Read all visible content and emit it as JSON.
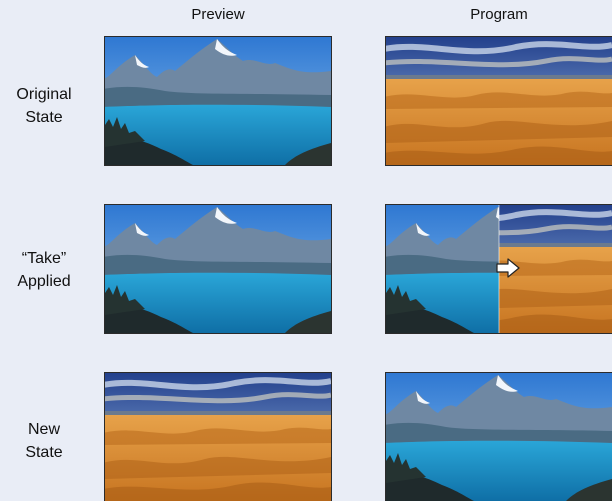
{
  "columns": {
    "preview": "Preview",
    "program": "Program"
  },
  "rows": [
    {
      "line1": "Original",
      "line2": "State"
    },
    {
      "line1": "“Take”",
      "line2": "Applied"
    },
    {
      "line1": "New",
      "line2": "State"
    }
  ],
  "colors": {
    "background": "#e9edf6",
    "sky": "#3f88d8",
    "lake": "#1d8fc4",
    "sand": "#d68a2c"
  },
  "thumbnails": [
    {
      "row": 0,
      "column": "preview",
      "scene": "mountain-lake"
    },
    {
      "row": 0,
      "column": "program",
      "scene": "desert-dunes"
    },
    {
      "row": 1,
      "column": "preview",
      "scene": "mountain-lake"
    },
    {
      "row": 1,
      "column": "program",
      "scene": "transition-lake-to-desert"
    },
    {
      "row": 2,
      "column": "preview",
      "scene": "desert-dunes"
    },
    {
      "row": 2,
      "column": "program",
      "scene": "mountain-lake"
    }
  ]
}
